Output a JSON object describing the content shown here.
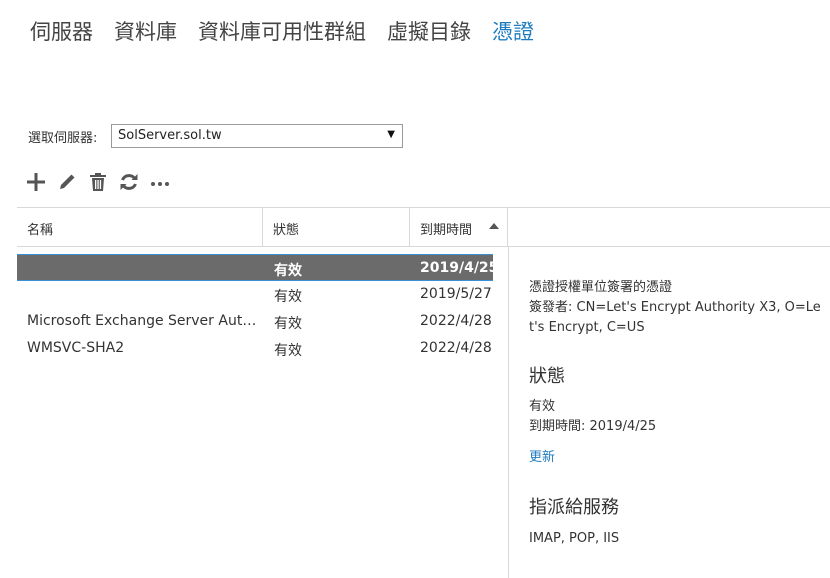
{
  "nav": {
    "items": [
      {
        "label": "伺服器"
      },
      {
        "label": "資料庫"
      },
      {
        "label": "資料庫可用性群組"
      },
      {
        "label": "虛擬目錄"
      },
      {
        "label": "憑證"
      }
    ],
    "active_index": 4
  },
  "server": {
    "label": "選取伺服器:",
    "selected": "SolServer.sol.tw"
  },
  "toolbar": {
    "buttons": [
      "plus-icon",
      "pencil-icon",
      "trash-icon",
      "refresh-icon",
      "more-icon"
    ]
  },
  "grid": {
    "columns": {
      "name": "名稱",
      "status": "狀態",
      "expiry": "到期時間"
    },
    "sort_direction": "ascending",
    "rows": [
      {
        "name": "",
        "status": "有效",
        "expiry": "2019/4/25",
        "selected": true
      },
      {
        "name": "",
        "status": "有效",
        "expiry": "2019/5/27",
        "selected": false
      },
      {
        "name": "Microsoft Exchange Server Auth ...",
        "status": "有效",
        "expiry": "2022/4/28",
        "selected": false
      },
      {
        "name": "WMSVC-SHA2",
        "status": "有效",
        "expiry": "2022/4/28",
        "selected": false
      }
    ]
  },
  "details": {
    "type": "憑證授權單位簽署的憑證",
    "issuer": "簽發者: CN=Let's Encrypt Authority X3, O=Let's Encrypt, C=US",
    "status_heading": "狀態",
    "status_value": "有效",
    "expiry": "到期時間: 2019/4/25",
    "renew_link": "更新",
    "services_heading": "指派給服務",
    "services_value": "IMAP, POP, IIS"
  },
  "colors": {
    "accent": "#1f7bbf",
    "selected_row_bg": "#6b6b6b",
    "selected_row_border": "#3b8fd6"
  }
}
